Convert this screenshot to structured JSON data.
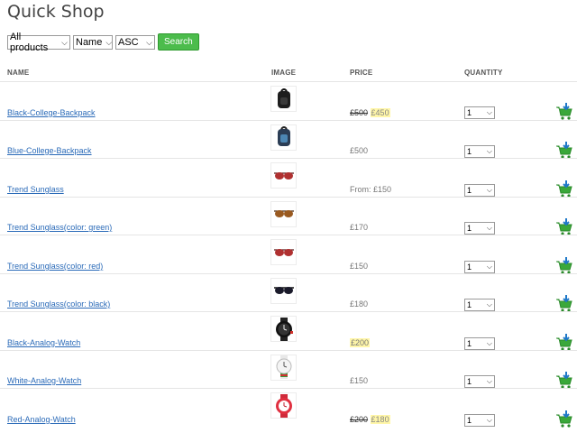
{
  "page_title": "Quick Shop",
  "filters": {
    "category": "All products",
    "sort_field": "Name",
    "sort_order": "ASC",
    "search_label": "Search"
  },
  "table": {
    "columns": {
      "name": "NAME",
      "image": "IMAGE",
      "price": "PRICE",
      "quantity": "QUANTITY"
    },
    "rows": [
      {
        "name": "Black-College-Backpack",
        "price_old": "£500",
        "price_new": "£450",
        "price_text": "",
        "quantity": "1",
        "image": "black-backpack"
      },
      {
        "name": "Blue-College-Backpack",
        "price_old": "",
        "price_new": "",
        "price_text": "£500",
        "quantity": "1",
        "image": "blue-backpack"
      },
      {
        "name": "Trend Sunglass",
        "price_old": "",
        "price_new": "",
        "price_text": "From: £150",
        "quantity": "1",
        "image": "sunglass-red"
      },
      {
        "name": "Trend Sunglass(color: green)",
        "price_old": "",
        "price_new": "",
        "price_text": "£170",
        "quantity": "1",
        "image": "sunglass-brown"
      },
      {
        "name": "Trend Sunglass(color: red)",
        "price_old": "",
        "price_new": "",
        "price_text": "£150",
        "quantity": "1",
        "image": "sunglass-red"
      },
      {
        "name": "Trend Sunglass(color: black)",
        "price_old": "",
        "price_new": "",
        "price_text": "£180",
        "quantity": "1",
        "image": "sunglass-black"
      },
      {
        "name": "Black-Analog-Watch",
        "price_old": "",
        "price_new": "",
        "price_text": "£200",
        "price_highlight": true,
        "quantity": "1",
        "image": "watch-black"
      },
      {
        "name": "White-Analog-Watch",
        "price_old": "",
        "price_new": "",
        "price_text": "£150",
        "quantity": "1",
        "image": "watch-white"
      },
      {
        "name": "Red-Analog-Watch",
        "price_old": "£200",
        "price_new": "£180",
        "price_text": "",
        "quantity": "1",
        "image": "watch-red"
      }
    ]
  },
  "icons": {
    "cart": "add-to-cart-icon",
    "dropdown": "chevron-down-icon"
  },
  "colors": {
    "link": "#2a6ab8",
    "search_button": "#4cbc4c",
    "cart_green": "#3aa83a",
    "cart_arrow": "#1f78c8",
    "price_highlight": "#fff6a8"
  }
}
